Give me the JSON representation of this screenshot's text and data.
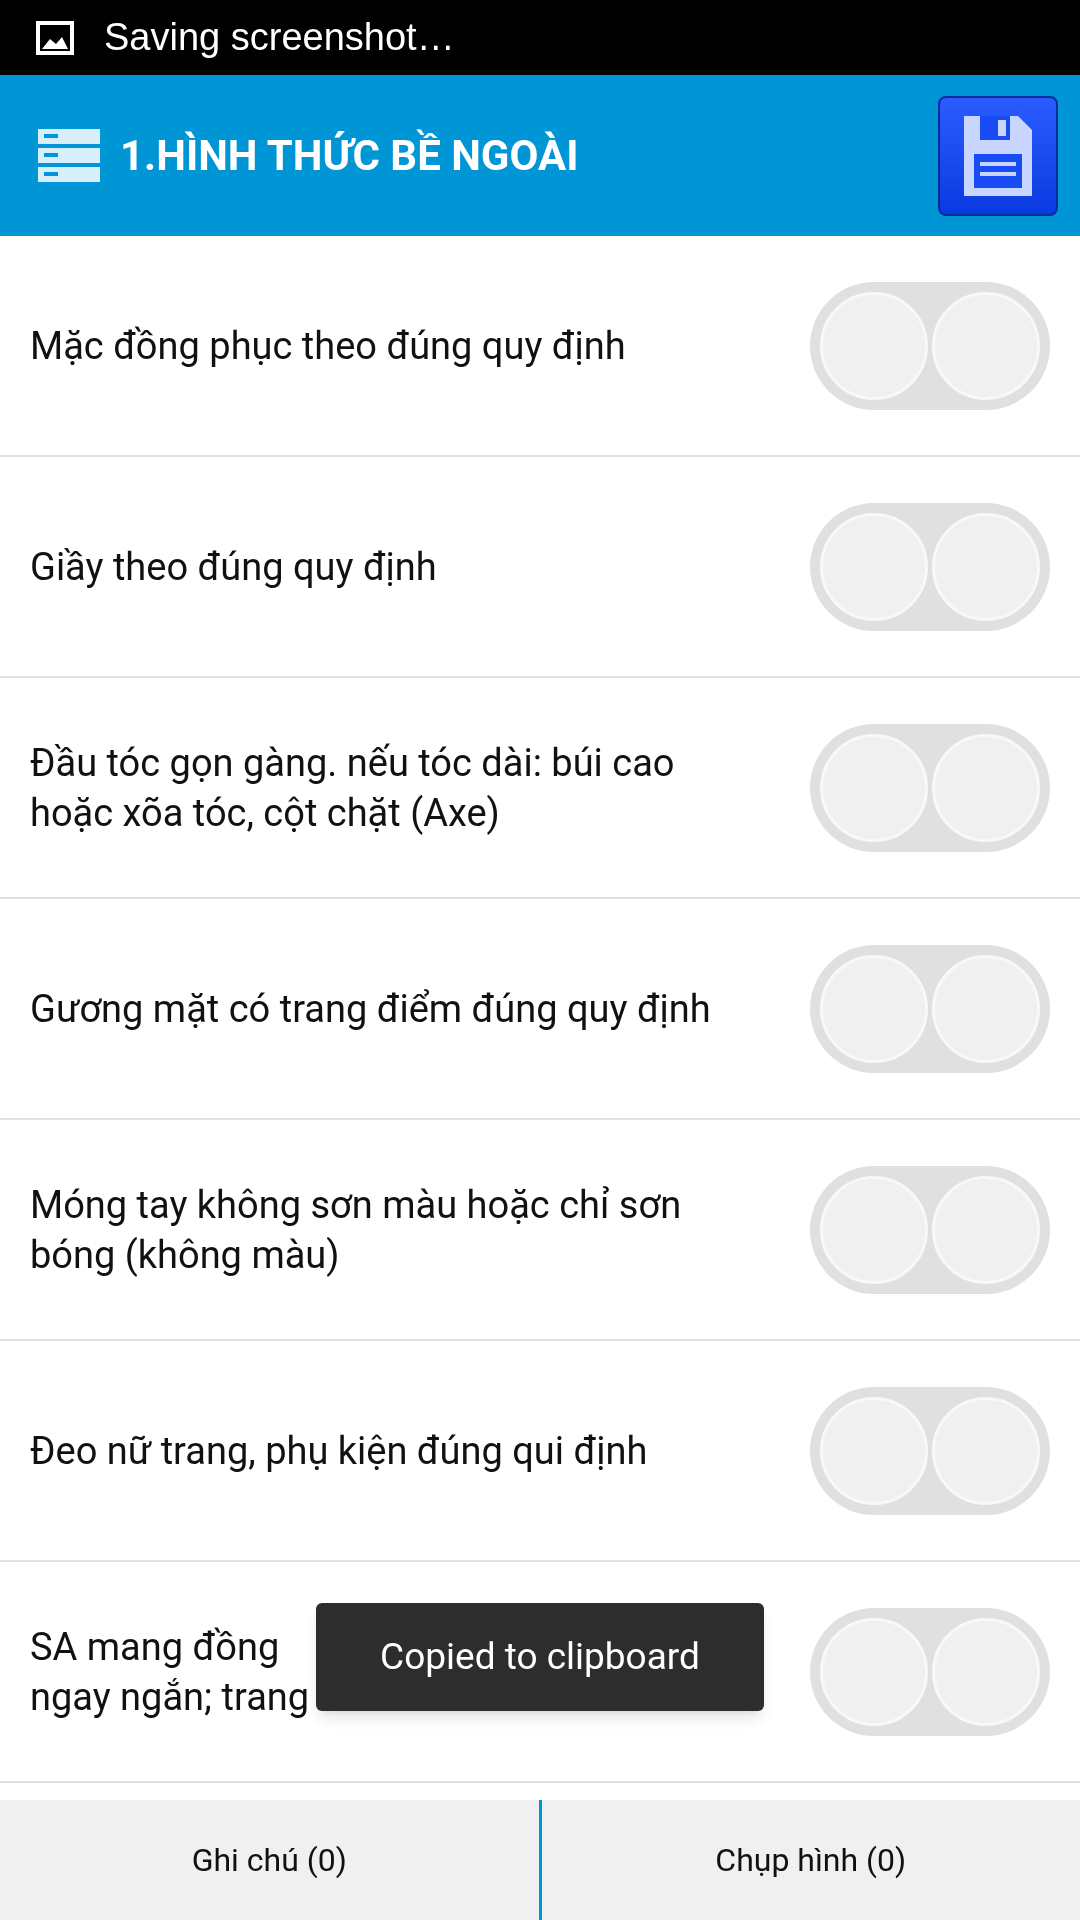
{
  "status_bar": {
    "notification": "Saving screenshot…"
  },
  "header": {
    "title": "1.HÌNH THỨC BỀ NGOÀI"
  },
  "items": [
    {
      "lines": [
        "Mặc đồng phục theo đúng quy định"
      ],
      "yes": false,
      "no": false
    },
    {
      "lines": [
        "Giầy theo đúng quy định"
      ],
      "yes": false,
      "no": false
    },
    {
      "lines": [
        "Đầu tóc gọn gàng. nếu tóc dài: búi cao",
        "hoặc xõa tóc, cột chặt (Axe)"
      ],
      "yes": false,
      "no": false
    },
    {
      "lines": [
        "Gương mặt có trang điểm đúng quy định"
      ],
      "yes": false,
      "no": false
    },
    {
      "lines": [
        "Móng tay không sơn màu hoặc chỉ sơn",
        "bóng (không màu)"
      ],
      "yes": false,
      "no": false
    },
    {
      "lines": [
        "Đeo nữ trang, phụ kiện đúng qui định"
      ],
      "yes": false,
      "no": false
    },
    {
      "lines": [
        "SA mang đồng",
        "ngay ngắn; trang"
      ],
      "yes": false,
      "no": false
    }
  ],
  "toast": "Copied to clipboard",
  "bottom_tabs": [
    {
      "label": "Ghi chú (0)"
    },
    {
      "label": "Chụp hình (0)"
    }
  ]
}
